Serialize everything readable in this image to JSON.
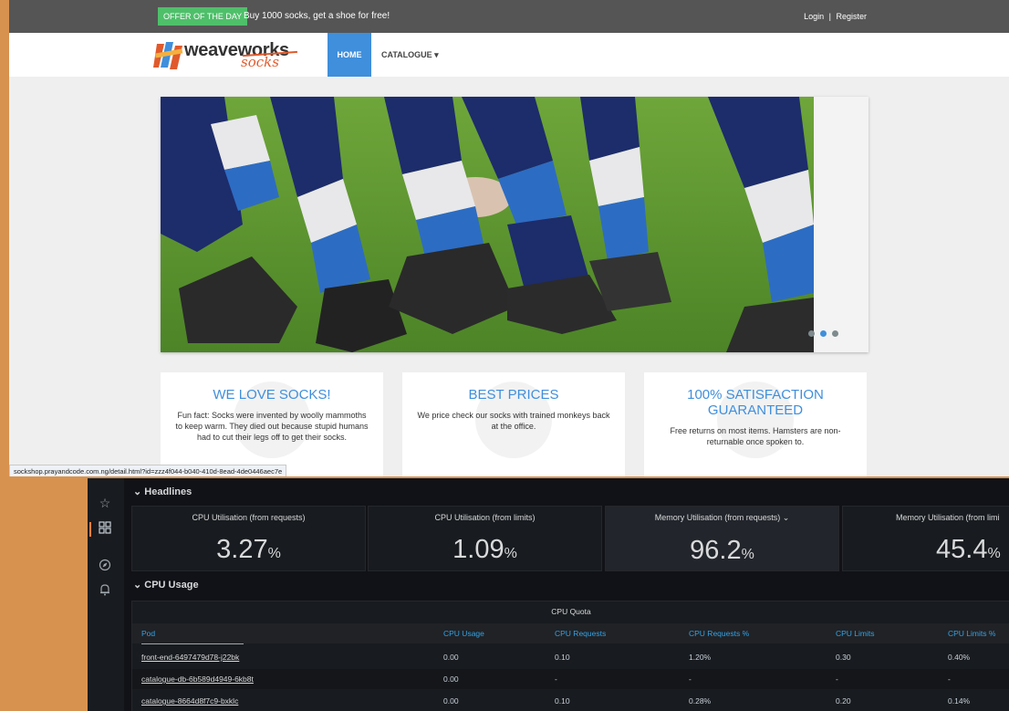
{
  "shop": {
    "offer_badge": "OFFER OF THE DAY",
    "offer_text": "Buy 1000 socks, get a shoe for free!",
    "login": "Login",
    "login_sep": "|",
    "register": "Register",
    "logo_weave": "weave",
    "logo_works": "works",
    "logo_socks": "socks",
    "nav_home": "HOME",
    "nav_catalogue": "CATALOGUE ▾",
    "cards": [
      {
        "title": "WE LOVE SOCKS!",
        "text": "Fun fact: Socks were invented by woolly mammoths to keep warm. They died out because stupid humans had to cut their legs off to get their socks."
      },
      {
        "title": "BEST PRICES",
        "text": "We price check our socks with trained monkeys back at the office."
      },
      {
        "title": "100% SATISFACTION GUARANTEED",
        "text": "Free returns on most items. Hamsters are non-returnable once spoken to."
      }
    ],
    "status_url": "sockshop.prayandcode.com.ng/detail.html?id=zzz4f044-b040-410d-8ead-4de0446aec7e"
  },
  "dashboard": {
    "headlines_title": "⌄ Headlines",
    "panels": [
      {
        "title": "CPU Utilisation (from requests)",
        "value": "3.27",
        "unit": "%"
      },
      {
        "title": "CPU Utilisation (from limits)",
        "value": "1.09",
        "unit": "%"
      },
      {
        "title": "Memory Utilisation (from requests) ⌄",
        "value": "96.2",
        "unit": "%"
      },
      {
        "title": "Memory Utilisation (from limi",
        "value": "45.4",
        "unit": "%"
      }
    ],
    "cpu_usage_title": "⌄ CPU Usage",
    "table": {
      "title": "CPU Quota",
      "headers": [
        "Pod",
        "CPU Usage",
        "CPU Requests",
        "CPU Requests %",
        "CPU Limits",
        "CPU Limits %"
      ],
      "rows": [
        [
          "front-end-6497479d78-j22bk",
          "0.00",
          "0.10",
          "1.20%",
          "0.30",
          "0.40%"
        ],
        [
          "catalogue-db-6b589d4949-6kb8t",
          "0.00",
          "-",
          "-",
          "-",
          "-"
        ],
        [
          "catalogue-8664d8f7c9-bxklc",
          "0.00",
          "0.10",
          "0.28%",
          "0.20",
          "0.14%"
        ]
      ]
    },
    "sidebar_icons": [
      "star-icon",
      "dashboards-icon",
      "explore-icon",
      "alerting-bell-icon"
    ]
  },
  "colors": {
    "accent_blue": "#3f8fdc",
    "offer_green": "#4fbf6a",
    "grafana_orange": "#f07f3a",
    "table_header_blue": "#33a2e5"
  }
}
